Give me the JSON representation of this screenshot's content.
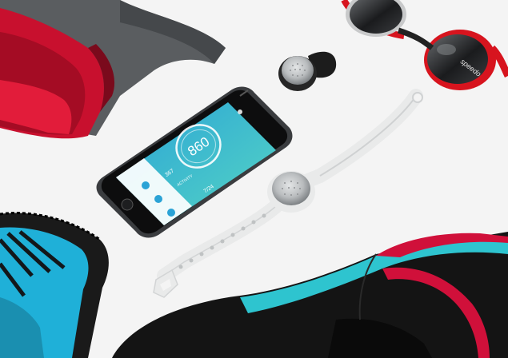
{
  "photo": {
    "colors": {
      "background": "#f4f4f4",
      "bag_red": "#c8102e",
      "bag_grey": "#5a5d60",
      "paddle_blue": "#1fb0d8",
      "swimsuit_black": "#141414",
      "swimsuit_teal": "#2ec4cf",
      "swimsuit_red": "#d0103a",
      "goggle_red": "#d7141e",
      "band_white": "#e9eaea",
      "pod_silver": "#b9bcbe",
      "phone_screen": "#3cc0c8"
    },
    "icons": [
      "phone-icon",
      "tracker-band-icon",
      "tracker-clip-icon",
      "goggles-icon"
    ]
  },
  "phone_screen": {
    "score": "860",
    "caption": "ACTIVITY",
    "stat_left": "367",
    "stat_right": "7/24"
  },
  "goggles": {
    "brand": "speedo"
  }
}
